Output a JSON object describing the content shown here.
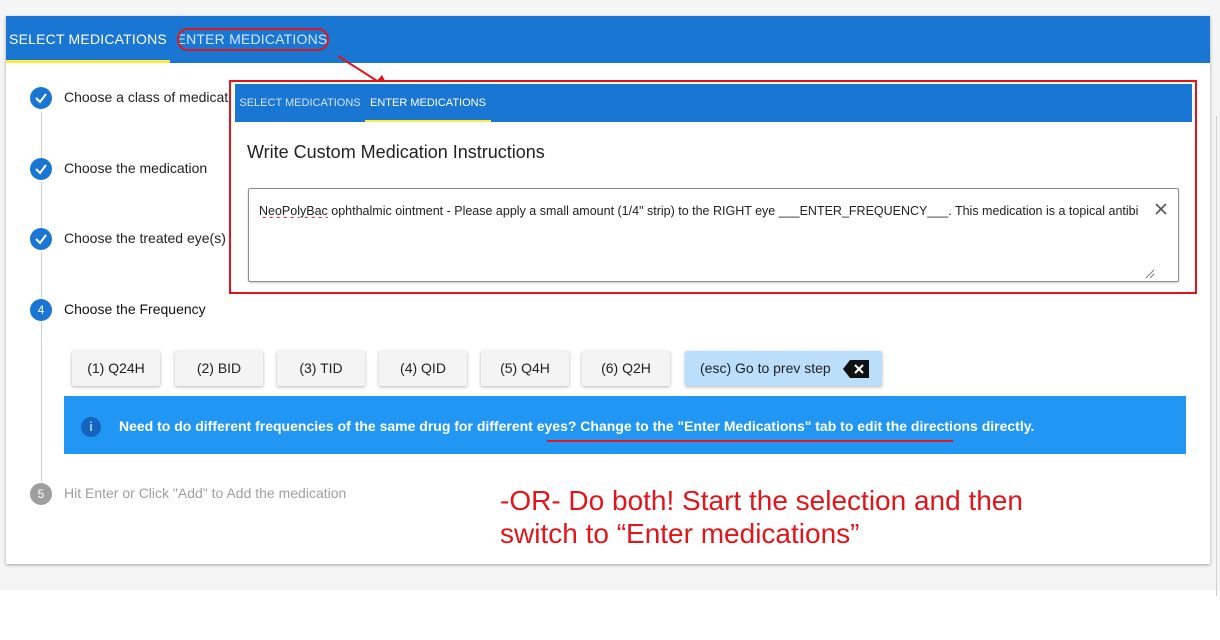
{
  "tabs": {
    "select": "SELECT MEDICATIONS",
    "enter": "ENTER MEDICATIONS"
  },
  "steps": [
    {
      "number": "",
      "label": "Choose a class of medicatio",
      "state": "done"
    },
    {
      "number": "",
      "label": "Choose the medication",
      "state": "done"
    },
    {
      "number": "",
      "label": "Choose the treated eye(s)",
      "state": "done"
    },
    {
      "number": "4",
      "label": "Choose the Frequency",
      "state": "active"
    },
    {
      "number": "5",
      "label": "Hit Enter or Click \"Add\" to Add the medication",
      "state": "pending"
    }
  ],
  "frequency_buttons": [
    "(1) Q24H",
    "(2) BID",
    "(3) TID",
    "(4) QID",
    "(5) Q4H",
    "(6) Q2H"
  ],
  "esc_button": "(esc) Go to prev step",
  "info": {
    "icon": "info-icon",
    "text_prefix": "Need to do different frequencies of the same drug for different eyes? ",
    "text_link": "Change to the \"Enter Medications\" tab to edit the directions directly."
  },
  "annotation_note": {
    "line1": "-OR- Do both! Start the selection and then",
    "line2": "switch to “Enter medications”"
  },
  "inset": {
    "tabs": {
      "select": "SELECT MEDICATIONS",
      "enter": "ENTER MEDICATIONS"
    },
    "title": "Write Custom Medication Instructions",
    "textbox_drug": "NeoPolyBac",
    "textbox_rest": " ophthalmic ointment - Please apply a small amount (1/4\" strip) to the RIGHT eye ___ENTER_FREQUENCY___.  This medication is a topical antibiotic."
  },
  "colors": {
    "primary": "#1976d2",
    "info": "#2196f3",
    "tab_indicator": "#ffeb3b",
    "annotation_red": "#e0161b"
  }
}
